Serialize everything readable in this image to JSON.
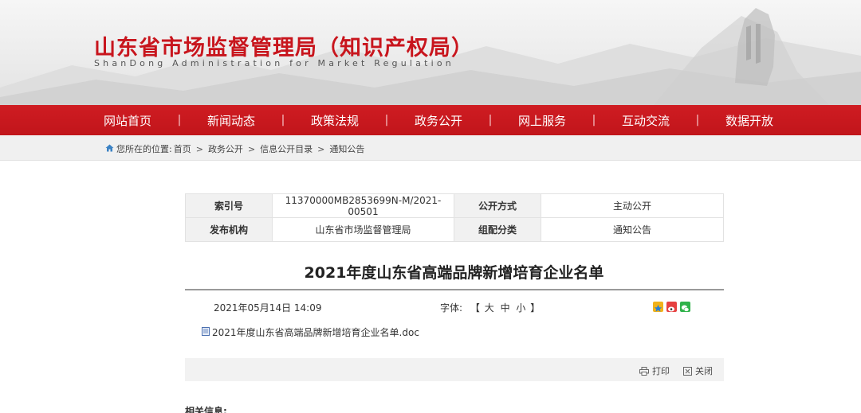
{
  "header": {
    "title": "山东省市场监督管理局（知识产权局）",
    "subtitle": "ShanDong Administration for Market Regulation"
  },
  "nav": [
    {
      "label": "网站首页"
    },
    {
      "label": "新闻动态"
    },
    {
      "label": "政策法规"
    },
    {
      "label": "政务公开"
    },
    {
      "label": "网上服务"
    },
    {
      "label": "互动交流"
    },
    {
      "label": "数据开放"
    }
  ],
  "nav_separator": "|",
  "breadcrumb": {
    "prefix": "您所在的位置:",
    "items": [
      "首页",
      "政务公开",
      "信息公开目录",
      "通知公告"
    ],
    "arrow": ">"
  },
  "info": {
    "index_label": "索引号",
    "index_value": "11370000MB2853699N-M/2021-00501",
    "mode_label": "公开方式",
    "mode_value": "主动公开",
    "org_label": "发布机构",
    "org_value": "山东省市场监督管理局",
    "category_label": "组配分类",
    "category_value": "通知公告"
  },
  "article": {
    "title": "2021年度山东省高端品牌新增培育企业名单",
    "date": "2021年05月14日 14:09",
    "font_label": "字体:",
    "font_open": "【",
    "font_large": "大",
    "font_medium": "中",
    "font_small": "小",
    "font_close": "】",
    "attachment": "2021年度山东省高端品牌新增培育企业名单.doc"
  },
  "toolbar": {
    "print_label": "打印",
    "close_label": "关闭"
  },
  "related_label": "相关信息:",
  "colors": {
    "brand_red": "#c8151d",
    "nav_red": "#c1151b"
  },
  "icons": [
    "home-icon",
    "doc-icon",
    "qzone-share-icon",
    "weibo-share-icon",
    "wechat-share-icon",
    "printer-icon",
    "close-window-icon"
  ]
}
